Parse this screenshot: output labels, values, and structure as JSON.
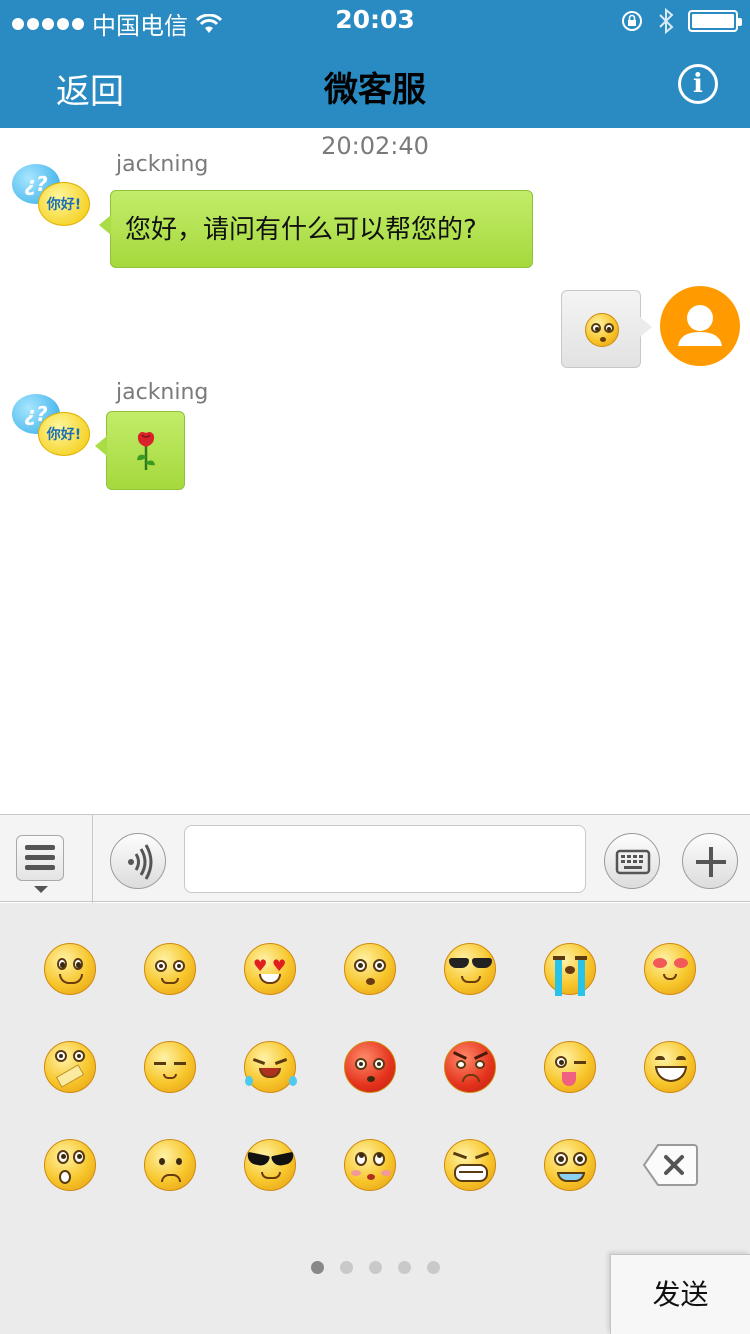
{
  "status_bar": {
    "carrier": "中国电信",
    "time": "20:03"
  },
  "nav": {
    "back_label": "返回",
    "title": "微客服",
    "info_icon": "info-icon",
    "info_glyph": "i"
  },
  "chat": {
    "timestamp": "20:02:40",
    "messages": [
      {
        "sender": "jackning",
        "side": "left",
        "type": "text",
        "text": "您好，请问有什么可以帮您的?"
      },
      {
        "sender": "me",
        "side": "right",
        "type": "emoji",
        "emoji": "angry-eyes-face"
      },
      {
        "sender": "jackning",
        "side": "left",
        "type": "emoji",
        "emoji": "rose"
      }
    ],
    "bot_avatar": {
      "bubble_text": "¿?",
      "greeting_text": "你好!"
    }
  },
  "toolbar": {
    "menu_icon": "menu-list-icon",
    "voice_icon": "voice-icon",
    "input_value": "",
    "input_placeholder": "",
    "keyboard_icon": "keyboard-icon",
    "plus_icon": "plus-icon"
  },
  "emoji_panel": {
    "rows": [
      [
        "smile",
        "awkward",
        "heart-eyes",
        "stare",
        "cool",
        "cry-tears",
        "blush"
      ],
      [
        "shush",
        "sleepy",
        "laugh-tears",
        "embarrassed",
        "angry",
        "tongue",
        "grin"
      ],
      [
        "surprised",
        "sad",
        "sunglasses-cool",
        "shy",
        "scream",
        "sweat",
        "delete"
      ]
    ],
    "page_count": 5,
    "current_page": 1,
    "send_label": "发送"
  },
  "colors": {
    "nav_background": "#2a8bc3",
    "bubble_green": "#b5e24f",
    "user_avatar": "#ff9a00"
  }
}
